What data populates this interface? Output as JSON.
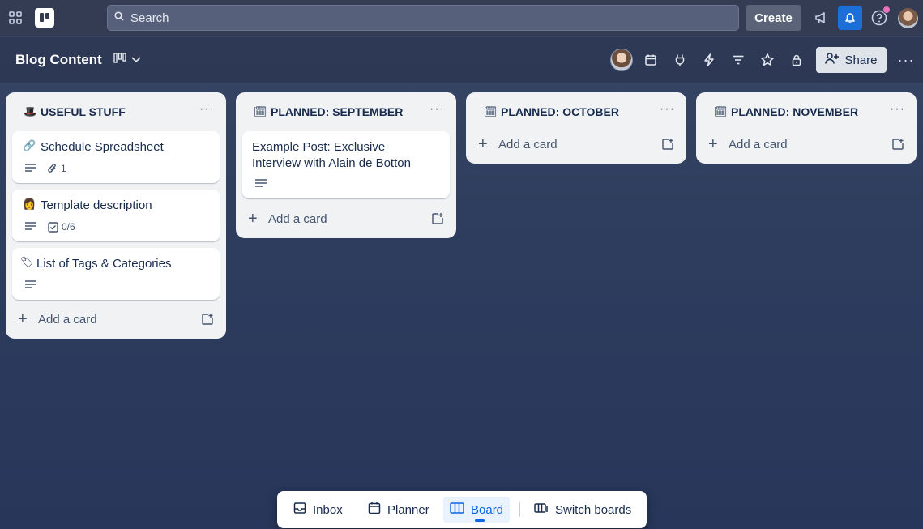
{
  "topbar": {
    "search_placeholder": "Search",
    "create_label": "Create",
    "icons": [
      "apps-grid-icon",
      "trello-logo",
      "search-icon",
      "megaphone-icon",
      "bell-icon",
      "help-icon",
      "user-avatar"
    ]
  },
  "board": {
    "title": "Blog Content",
    "share_label": "Share",
    "header_icons": [
      "board-view-icon",
      "chevron-down-icon",
      "calendar-icon",
      "power-up-icon",
      "automation-icon",
      "filter-icon",
      "star-icon",
      "lock-icon",
      "add-member-icon",
      "more-icon"
    ]
  },
  "lists": [
    {
      "emoji": "🎩",
      "title": "USEFUL STUFF",
      "cards": [
        {
          "emoji": "🔗",
          "title": "Schedule Spreadsheet",
          "attachments": "1"
        },
        {
          "emoji": "👩",
          "title": "Template description",
          "checklist": "0/6"
        },
        {
          "emoji": "🏷",
          "title": "List of Tags & Categories"
        }
      ],
      "add_label": "Add a card"
    },
    {
      "emoji": "🗓",
      "title": "PLANNED: SEPTEMBER",
      "cards": [
        {
          "title_line1": "Example Post: Exclusive",
          "title_line2": "Interview with Alain de Botton"
        }
      ],
      "add_label": "Add a card"
    },
    {
      "emoji": "🗓",
      "title": "PLANNED: OCTOBER",
      "cards": [],
      "add_label": "Add a card"
    },
    {
      "emoji": "🗓",
      "title": "PLANNED: NOVEMBER",
      "cards": [],
      "add_label": "Add a card"
    }
  ],
  "bottom_nav": {
    "items": [
      {
        "label": "Inbox"
      },
      {
        "label": "Planner"
      },
      {
        "label": "Board"
      },
      {
        "label": "Switch boards"
      }
    ],
    "active": "Board"
  },
  "colors": {
    "accent": "#0c66e4",
    "notification_active": "#1d6fd8",
    "list_bg": "#f1f2f4"
  }
}
